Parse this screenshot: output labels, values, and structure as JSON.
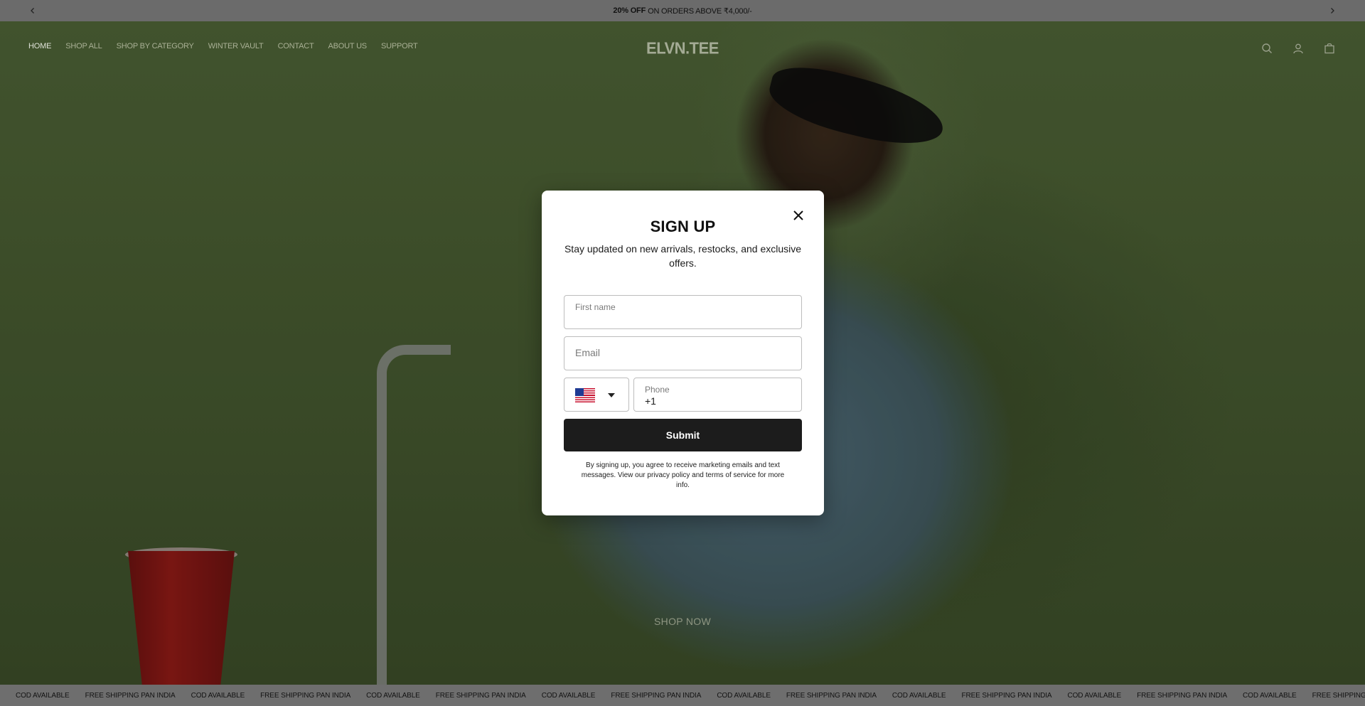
{
  "announcement": {
    "bold_text": "20% OFF",
    "text": "ON ORDERS ABOVE ₹4,000/-",
    "prev_icon": "chevron-left-icon",
    "next_icon": "chevron-right-icon"
  },
  "nav": {
    "items": [
      "HOME",
      "SHOP ALL",
      "SHOP BY CATEGORY",
      "WINTER VAULT",
      "CONTACT",
      "ABOUT US",
      "SUPPORT"
    ],
    "active": "HOME"
  },
  "logo": "ELVN.TEE",
  "header_icons": [
    "search-icon",
    "account-icon",
    "cart-icon"
  ],
  "hero": {
    "cta": "SHOP NOW"
  },
  "modal": {
    "title": "SIGN UP",
    "subtitle": "Stay updated on new arrivals, restocks, and exclusive offers.",
    "first_name_placeholder": "First name",
    "email_placeholder": "Email",
    "phone_label": "Phone",
    "phone_value": "+1",
    "country_flag": "us-flag-icon",
    "submit_label": "Submit",
    "legal": "By signing up, you agree to receive marketing emails and text messages. View our privacy policy and terms of service for more info."
  },
  "marquee": {
    "items": [
      "COD AVAILABLE",
      "FREE SHIPPING PAN INDIA",
      "COD AVAILABLE",
      "FREE SHIPPING PAN INDIA",
      "COD AVAILABLE",
      "FREE SHIPPING PAN INDIA",
      "COD AVAILABLE",
      "FREE SHIPPING PAN INDIA",
      "COD AVAILABLE",
      "FREE SHIPPING PAN INDIA",
      "COD AVAILABLE",
      "FREE SHIPPING PAN INDIA",
      "COD AVAILABLE",
      "FREE SHIPPING PAN INDIA",
      "COD AVAILABLE",
      "FREE SHIPPING PAN INDIA"
    ]
  },
  "colors": {
    "announcement_bg": "#6b6b6b",
    "hero_bg": "#4a5e34",
    "button_bg": "#1c1c1c"
  }
}
